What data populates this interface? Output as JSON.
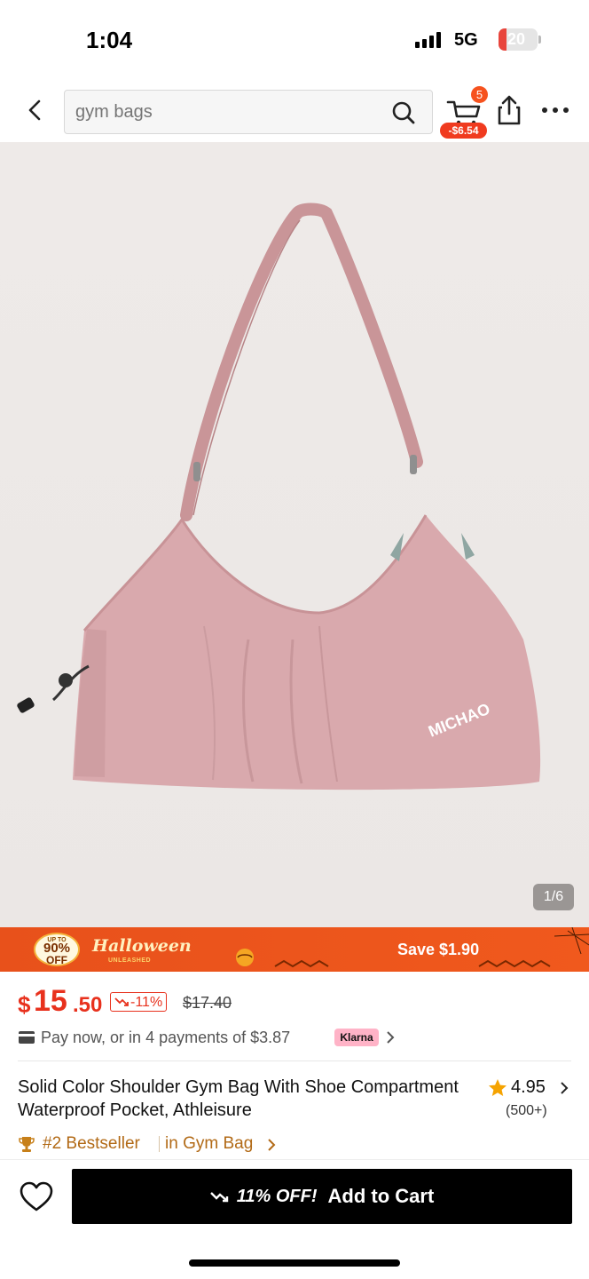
{
  "status_bar": {
    "time": "1:04",
    "network": "5G",
    "battery": "20",
    "battery_level": 0.2
  },
  "header": {
    "search_placeholder": "gym bags",
    "cart_count": "5",
    "cart_discount": "-$6.54"
  },
  "gallery": {
    "brand_on_bag": "MICHAO",
    "page_indicator": "1/6",
    "bag_color": "#d9a9ad"
  },
  "promo": {
    "badge_top": "UP TO",
    "badge_percent": "90%",
    "badge_off": "OFF",
    "title": "Halloween",
    "subtitle": "UNLEASHED",
    "save_text": "Save $1.90",
    "color": "#e8511b"
  },
  "price": {
    "currency": "$",
    "whole": "15",
    "cents": ".50",
    "discount": "-11%",
    "original": "$17.40",
    "color": "#e8311d"
  },
  "payment": {
    "text": "Pay now, or in 4 payments of $3.87",
    "provider": "Klarna"
  },
  "product": {
    "title": "Solid Color Shoulder Gym Bag With Shoe Compartment Waterproof Pocket, Athleisure",
    "rating": "4.95",
    "rating_count": "(500+)",
    "bestseller_rank": "#2 Bestseller",
    "bestseller_category": "in Gym Bag"
  },
  "bottom_bar": {
    "discount_label": "11% OFF!",
    "add_to_cart": "Add to Cart"
  },
  "icons": [
    "back-icon",
    "search-icon",
    "cart-icon",
    "share-icon",
    "more-icon",
    "card-icon",
    "chevron-right-icon",
    "star-icon",
    "trophy-icon",
    "heart-icon",
    "trend-down-icon"
  ]
}
